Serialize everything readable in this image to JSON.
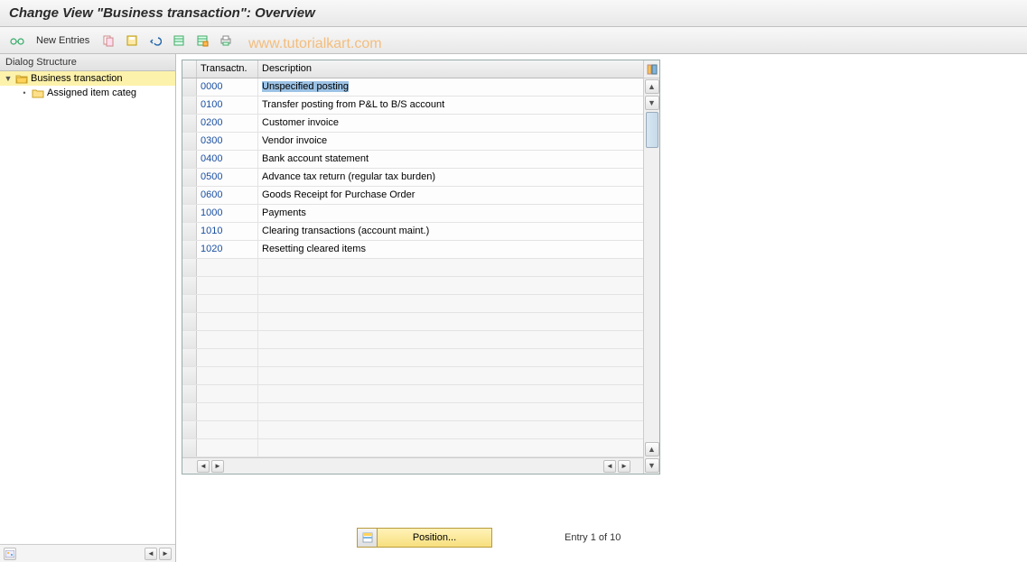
{
  "title": "Change View \"Business transaction\": Overview",
  "toolbar": {
    "new_entries_label": "New Entries"
  },
  "watermark": "www.tutorialkart.com",
  "tree": {
    "header": "Dialog Structure",
    "root": {
      "label": "Business transaction",
      "expanded": true,
      "selected": true
    },
    "child": {
      "label": "Assigned item categ"
    }
  },
  "table": {
    "col_txn": "Transactn.",
    "col_desc": "Description",
    "rows": [
      {
        "txn": "0000",
        "desc": "Unspecified posting",
        "selected": true
      },
      {
        "txn": "0100",
        "desc": "Transfer posting from P&L to B/S account"
      },
      {
        "txn": "0200",
        "desc": "Customer invoice"
      },
      {
        "txn": "0300",
        "desc": "Vendor invoice"
      },
      {
        "txn": "0400",
        "desc": "Bank account statement"
      },
      {
        "txn": "0500",
        "desc": "Advance tax return (regular tax burden)"
      },
      {
        "txn": "0600",
        "desc": "Goods Receipt for Purchase Order"
      },
      {
        "txn": "1000",
        "desc": "Payments"
      },
      {
        "txn": "1010",
        "desc": "Clearing transactions (account maint.)"
      },
      {
        "txn": "1020",
        "desc": "Resetting cleared items"
      }
    ],
    "empty_rows": 11
  },
  "footer": {
    "position_label": "Position...",
    "entry_text": "Entry 1 of 10"
  }
}
